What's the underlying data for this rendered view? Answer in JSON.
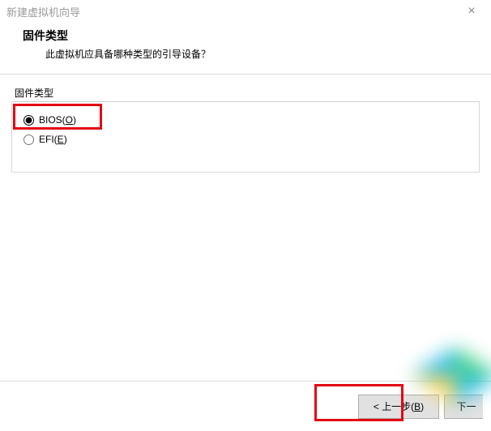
{
  "window": {
    "title": "新建虚拟机向导"
  },
  "header": {
    "title": "固件类型",
    "subtitle": "此虚拟机应具备哪种类型的引导设备？"
  },
  "group": {
    "label": "固件类型",
    "options": [
      {
        "id": "bios",
        "label_pre": "BIOS(",
        "label_u": "O",
        "label_post": ")",
        "selected": true
      },
      {
        "id": "efi",
        "label_pre": "EFI(",
        "label_u": "E",
        "label_post": ")",
        "selected": false
      }
    ]
  },
  "footer": {
    "back_pre": "< 上一步(",
    "back_u": "B",
    "back_post": ")",
    "next_pre": "下一",
    "next_rest": ""
  }
}
